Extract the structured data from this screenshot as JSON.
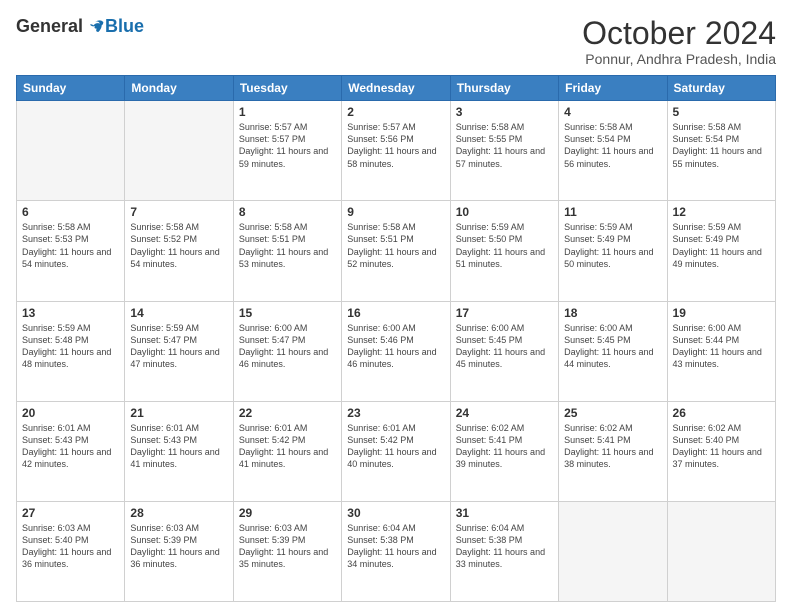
{
  "logo": {
    "general": "General",
    "blue": "Blue"
  },
  "title": "October 2024",
  "location": "Ponnur, Andhra Pradesh, India",
  "days_of_week": [
    "Sunday",
    "Monday",
    "Tuesday",
    "Wednesday",
    "Thursday",
    "Friday",
    "Saturday"
  ],
  "weeks": [
    [
      {
        "day": "",
        "info": ""
      },
      {
        "day": "",
        "info": ""
      },
      {
        "day": "1",
        "info": "Sunrise: 5:57 AM\nSunset: 5:57 PM\nDaylight: 11 hours and 59 minutes."
      },
      {
        "day": "2",
        "info": "Sunrise: 5:57 AM\nSunset: 5:56 PM\nDaylight: 11 hours and 58 minutes."
      },
      {
        "day": "3",
        "info": "Sunrise: 5:58 AM\nSunset: 5:55 PM\nDaylight: 11 hours and 57 minutes."
      },
      {
        "day": "4",
        "info": "Sunrise: 5:58 AM\nSunset: 5:54 PM\nDaylight: 11 hours and 56 minutes."
      },
      {
        "day": "5",
        "info": "Sunrise: 5:58 AM\nSunset: 5:54 PM\nDaylight: 11 hours and 55 minutes."
      }
    ],
    [
      {
        "day": "6",
        "info": "Sunrise: 5:58 AM\nSunset: 5:53 PM\nDaylight: 11 hours and 54 minutes."
      },
      {
        "day": "7",
        "info": "Sunrise: 5:58 AM\nSunset: 5:52 PM\nDaylight: 11 hours and 54 minutes."
      },
      {
        "day": "8",
        "info": "Sunrise: 5:58 AM\nSunset: 5:51 PM\nDaylight: 11 hours and 53 minutes."
      },
      {
        "day": "9",
        "info": "Sunrise: 5:58 AM\nSunset: 5:51 PM\nDaylight: 11 hours and 52 minutes."
      },
      {
        "day": "10",
        "info": "Sunrise: 5:59 AM\nSunset: 5:50 PM\nDaylight: 11 hours and 51 minutes."
      },
      {
        "day": "11",
        "info": "Sunrise: 5:59 AM\nSunset: 5:49 PM\nDaylight: 11 hours and 50 minutes."
      },
      {
        "day": "12",
        "info": "Sunrise: 5:59 AM\nSunset: 5:49 PM\nDaylight: 11 hours and 49 minutes."
      }
    ],
    [
      {
        "day": "13",
        "info": "Sunrise: 5:59 AM\nSunset: 5:48 PM\nDaylight: 11 hours and 48 minutes."
      },
      {
        "day": "14",
        "info": "Sunrise: 5:59 AM\nSunset: 5:47 PM\nDaylight: 11 hours and 47 minutes."
      },
      {
        "day": "15",
        "info": "Sunrise: 6:00 AM\nSunset: 5:47 PM\nDaylight: 11 hours and 46 minutes."
      },
      {
        "day": "16",
        "info": "Sunrise: 6:00 AM\nSunset: 5:46 PM\nDaylight: 11 hours and 46 minutes."
      },
      {
        "day": "17",
        "info": "Sunrise: 6:00 AM\nSunset: 5:45 PM\nDaylight: 11 hours and 45 minutes."
      },
      {
        "day": "18",
        "info": "Sunrise: 6:00 AM\nSunset: 5:45 PM\nDaylight: 11 hours and 44 minutes."
      },
      {
        "day": "19",
        "info": "Sunrise: 6:00 AM\nSunset: 5:44 PM\nDaylight: 11 hours and 43 minutes."
      }
    ],
    [
      {
        "day": "20",
        "info": "Sunrise: 6:01 AM\nSunset: 5:43 PM\nDaylight: 11 hours and 42 minutes."
      },
      {
        "day": "21",
        "info": "Sunrise: 6:01 AM\nSunset: 5:43 PM\nDaylight: 11 hours and 41 minutes."
      },
      {
        "day": "22",
        "info": "Sunrise: 6:01 AM\nSunset: 5:42 PM\nDaylight: 11 hours and 41 minutes."
      },
      {
        "day": "23",
        "info": "Sunrise: 6:01 AM\nSunset: 5:42 PM\nDaylight: 11 hours and 40 minutes."
      },
      {
        "day": "24",
        "info": "Sunrise: 6:02 AM\nSunset: 5:41 PM\nDaylight: 11 hours and 39 minutes."
      },
      {
        "day": "25",
        "info": "Sunrise: 6:02 AM\nSunset: 5:41 PM\nDaylight: 11 hours and 38 minutes."
      },
      {
        "day": "26",
        "info": "Sunrise: 6:02 AM\nSunset: 5:40 PM\nDaylight: 11 hours and 37 minutes."
      }
    ],
    [
      {
        "day": "27",
        "info": "Sunrise: 6:03 AM\nSunset: 5:40 PM\nDaylight: 11 hours and 36 minutes."
      },
      {
        "day": "28",
        "info": "Sunrise: 6:03 AM\nSunset: 5:39 PM\nDaylight: 11 hours and 36 minutes."
      },
      {
        "day": "29",
        "info": "Sunrise: 6:03 AM\nSunset: 5:39 PM\nDaylight: 11 hours and 35 minutes."
      },
      {
        "day": "30",
        "info": "Sunrise: 6:04 AM\nSunset: 5:38 PM\nDaylight: 11 hours and 34 minutes."
      },
      {
        "day": "31",
        "info": "Sunrise: 6:04 AM\nSunset: 5:38 PM\nDaylight: 11 hours and 33 minutes."
      },
      {
        "day": "",
        "info": ""
      },
      {
        "day": "",
        "info": ""
      }
    ]
  ]
}
